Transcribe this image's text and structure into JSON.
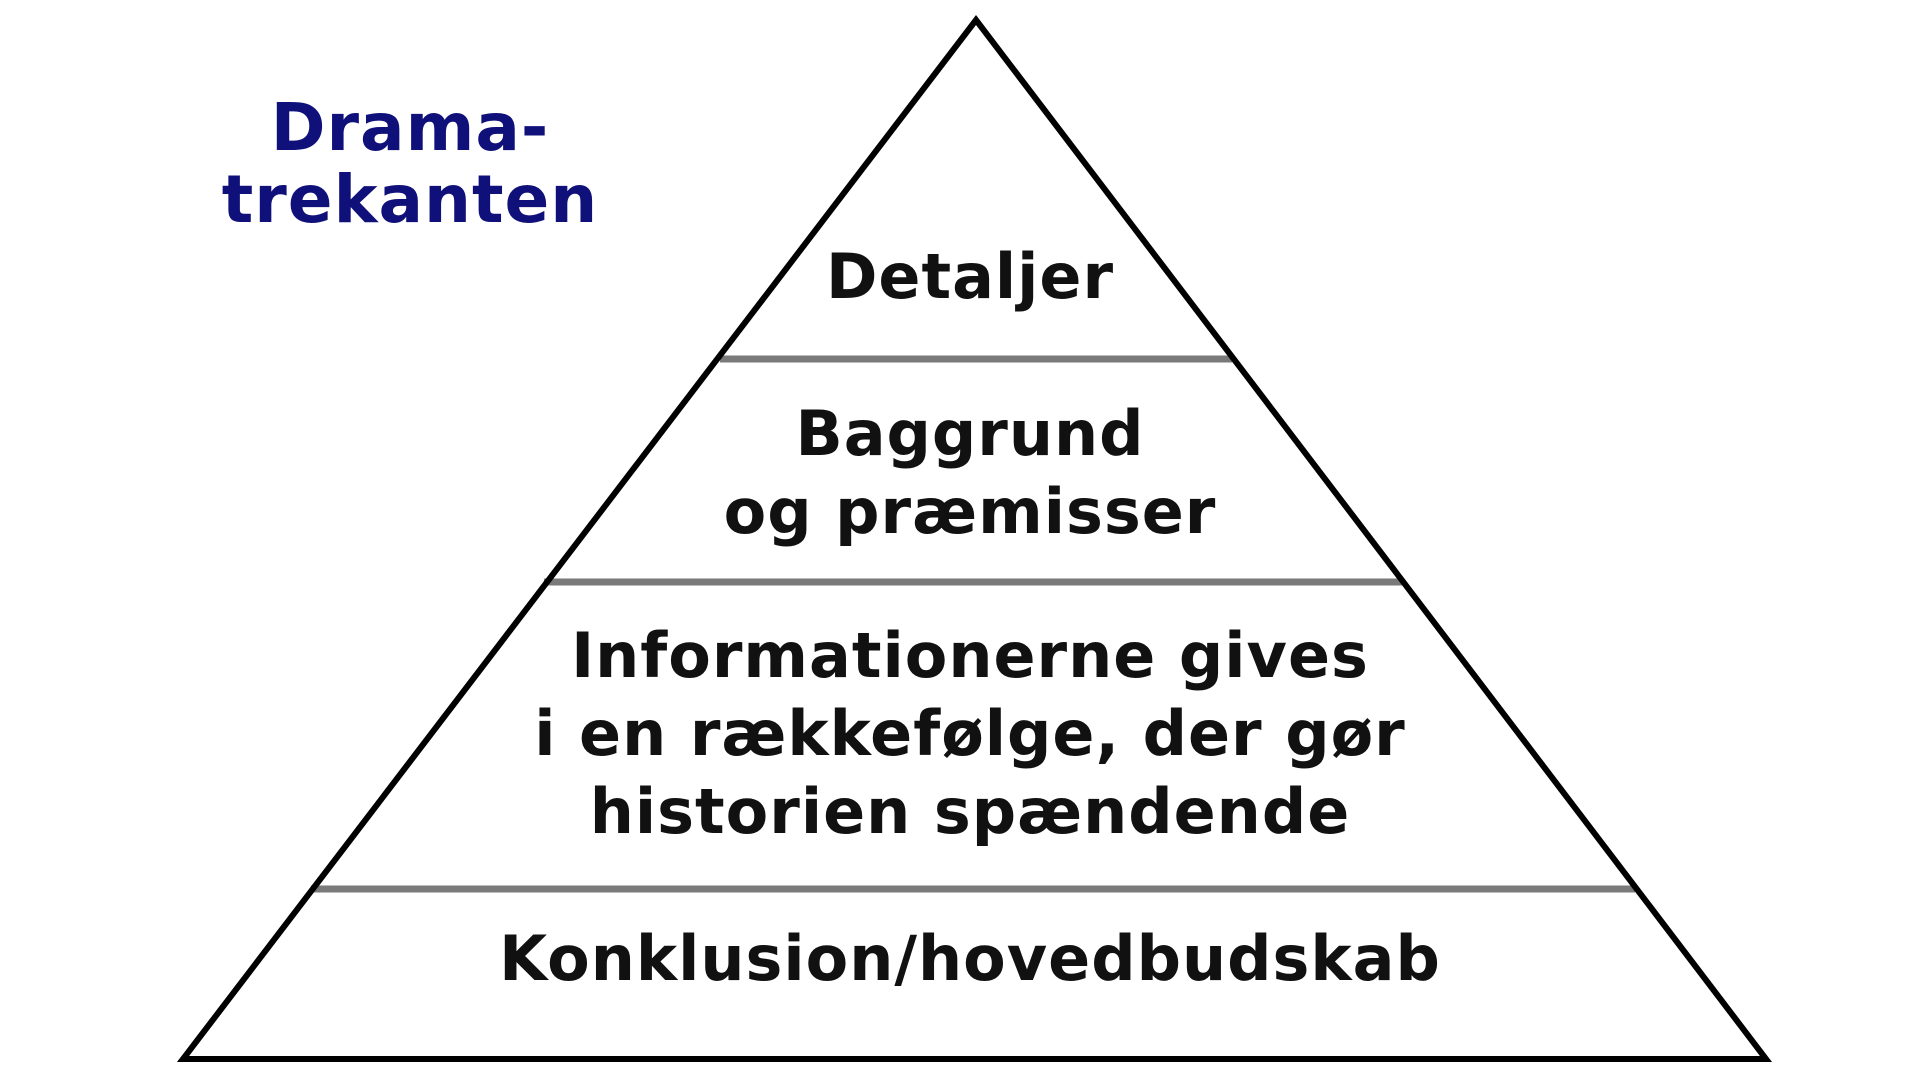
{
  "title": {
    "line1": "Drama-",
    "line2": "trekanten"
  },
  "tiers": [
    {
      "lines": [
        "Detaljer"
      ]
    },
    {
      "lines": [
        "Baggrund",
        "og præmisser"
      ]
    },
    {
      "lines": [
        "Informationerne gives",
        "i en rækkefølge, der gør",
        "historien spændende"
      ]
    },
    {
      "lines": [
        "Konklusion/hovedbudskab"
      ]
    }
  ],
  "colors": {
    "title": "#10107a",
    "text": "#111111",
    "outline": "#000000",
    "divider": "#7a7a7a",
    "background": "#ffffff"
  }
}
